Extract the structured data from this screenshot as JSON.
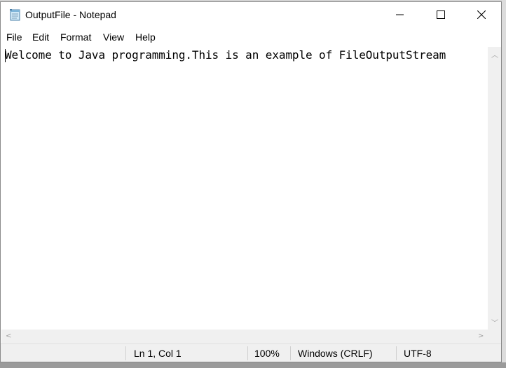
{
  "window": {
    "title": "OutputFile - Notepad",
    "controls": {
      "minimize_icon": "minimize-icon",
      "maximize_icon": "maximize-icon",
      "close_icon": "close-icon"
    }
  },
  "menu": {
    "items": [
      {
        "label": "File"
      },
      {
        "label": "Edit"
      },
      {
        "label": "Format"
      },
      {
        "label": "View"
      },
      {
        "label": "Help"
      }
    ]
  },
  "editor": {
    "content": "Welcome to Java programming.This is an example of FileOutputStream"
  },
  "status": {
    "position": "Ln 1, Col 1",
    "zoom": "100%",
    "line_ending": "Windows (CRLF)",
    "encoding": "UTF-8"
  },
  "colors": {
    "window_bg": "#ffffff",
    "statusbar_bg": "#f0f0f0",
    "scrollbar_bg": "#f0f0f0"
  }
}
